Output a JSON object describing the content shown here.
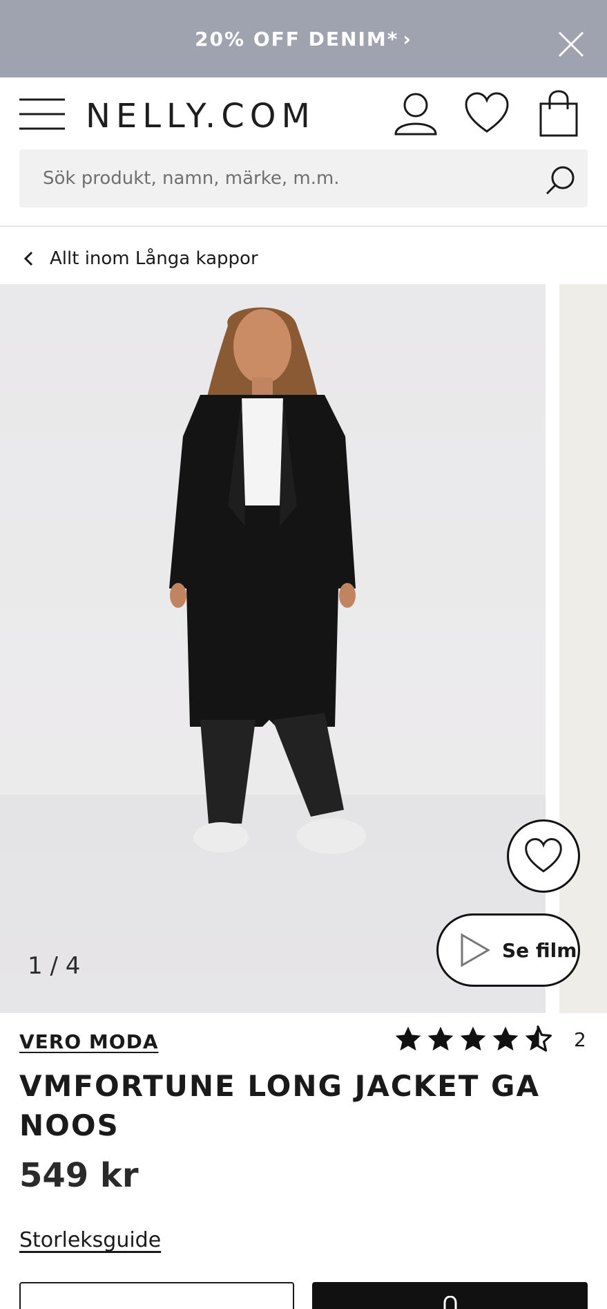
{
  "promo": {
    "text": "20% OFF DENIM*",
    "chevron": "›",
    "close_icon": "close-icon"
  },
  "header": {
    "logo": "NELLY.COM",
    "icons": [
      "menu-icon",
      "user-icon",
      "heart-icon",
      "bag-icon"
    ]
  },
  "search": {
    "placeholder": "Sök produkt, namn, märke, m.m.",
    "value": "",
    "icon": "search-icon"
  },
  "breadcrumb": {
    "label": "Allt inom Långa kappor",
    "icon": "chevron-left-icon"
  },
  "gallery": {
    "counter": "1 / 4",
    "film_label": "Se film",
    "wishlist_icon": "heart-icon",
    "play_icon": "play-icon"
  },
  "product": {
    "brand": "VERO MODA",
    "title": "VMFORTUNE LONG JACKET GA NOOS",
    "price": "549 kr",
    "rating_stars": 4.5,
    "review_count": "2",
    "size_guide": "Storleksguide"
  },
  "colors": {
    "promo_bg": "#9fa3b0",
    "search_bg": "#f1f1f1",
    "primary": "#111111"
  }
}
